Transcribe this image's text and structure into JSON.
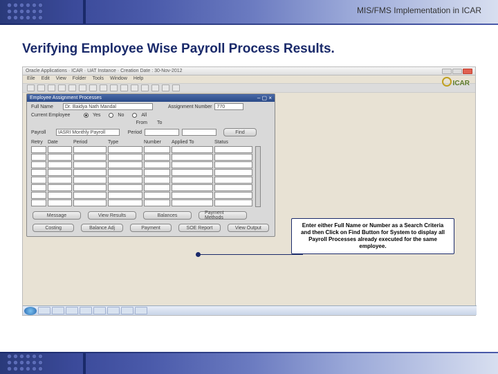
{
  "header": {
    "title": "MIS/FMS Implementation in ICAR"
  },
  "page": {
    "title": "Verifying Employee Wise Payroll Process Results."
  },
  "window": {
    "title": "Oracle Applications · ICAR · UAT Instance · Creation Date : 30-Nov-2012",
    "brand": "ICAR"
  },
  "menu": [
    "Eile",
    "Edit",
    "View",
    "Folder",
    "Tools",
    "Window",
    "Help"
  ],
  "form": {
    "title": "Employee Assignment Processes",
    "full_name_label": "Full Name",
    "full_name_value": "Dr. Baidya Nath Mandal",
    "assignment_label": "Assignment Number",
    "assignment_value": "770",
    "current_label": "Current Employee",
    "radio_yes": "Yes",
    "radio_no": "No",
    "radio_all": "All",
    "from_label": "From",
    "to_label": "To",
    "payroll_label": "Payroll",
    "payroll_value": "IASRI Monthly Payroll",
    "period_label": "Period",
    "find_label": "Find",
    "columns": {
      "retry": "Retry",
      "date": "Date",
      "period": "Period",
      "type": "Type",
      "number": "Number",
      "applied": "Applied To",
      "status": "Status"
    },
    "buttons_row1": [
      "Message",
      "View Results",
      "Balances",
      "Payment Methods"
    ],
    "buttons_row2": [
      "Costing",
      "Balance Adj",
      "Payment",
      "SOE Report",
      "View Output"
    ]
  },
  "callout": "Enter either Full Name or Number as a Search Criteria and then Click on Find Button for System to display all Payroll Processes already executed for the same employee."
}
